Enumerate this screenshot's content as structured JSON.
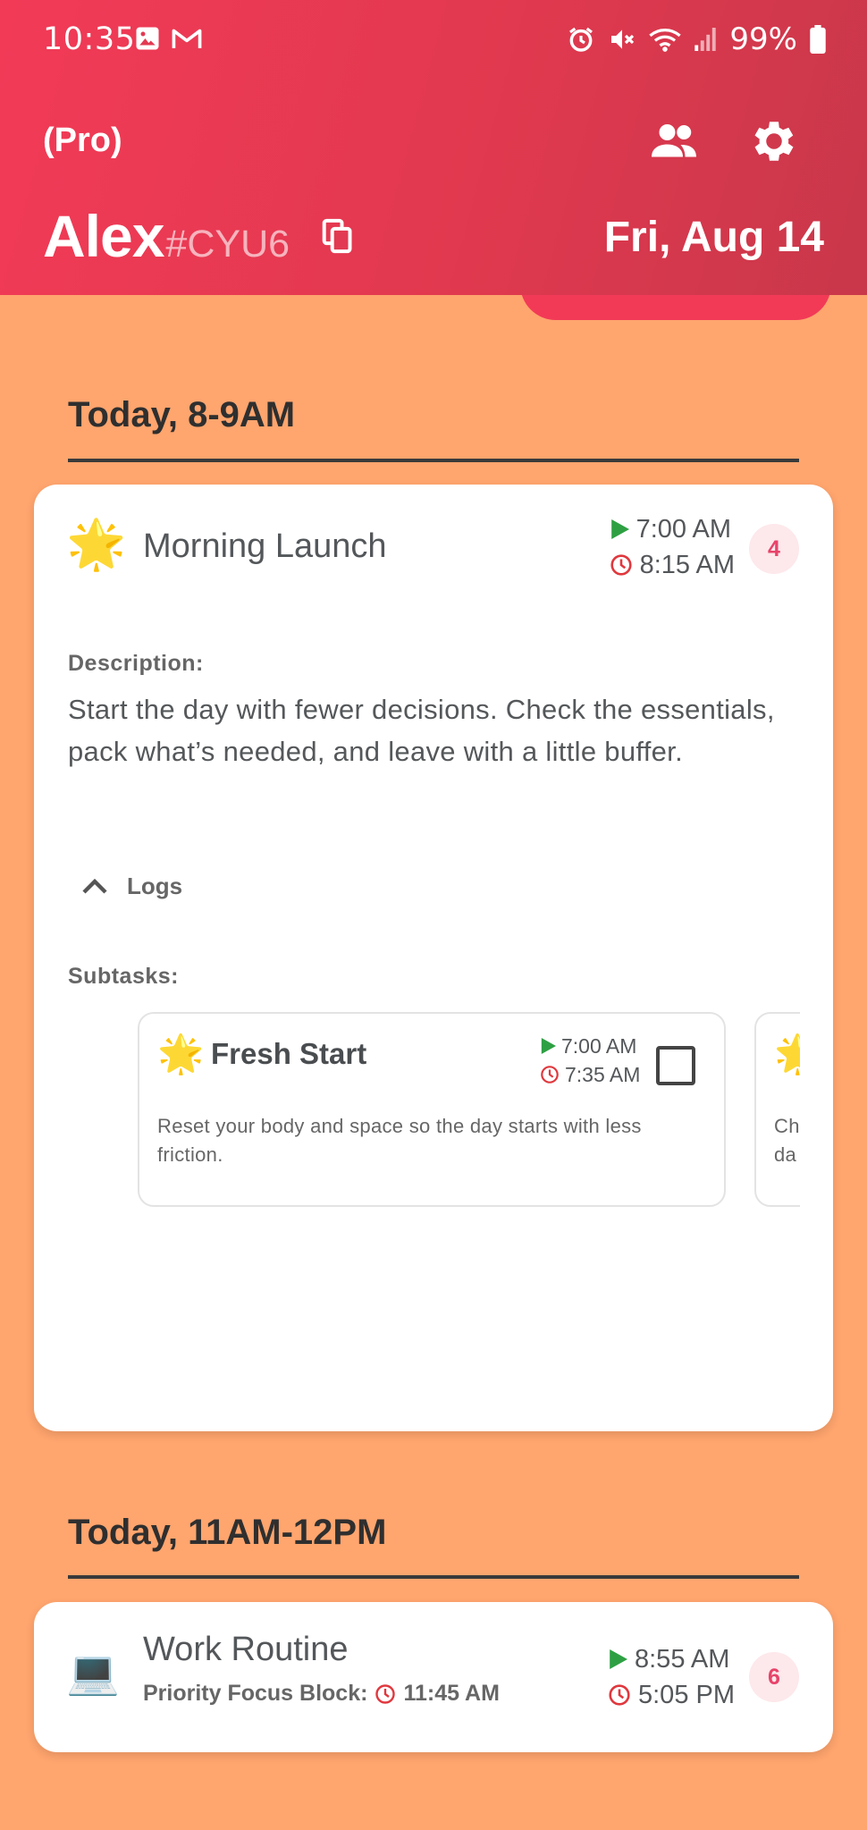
{
  "colors": {
    "header_start": "#F23A57",
    "header_end": "#C9374A",
    "background": "#FFA56E",
    "badge_text": "#E8436A",
    "play_green": "#2EA043",
    "clock_red": "#E0383E"
  },
  "status_bar": {
    "time": "10:35",
    "battery": "99%",
    "left_icons": [
      "image-icon",
      "gmail-icon"
    ],
    "right_icons": [
      "alarm-icon",
      "mute-icon",
      "wifi-icon",
      "signal-icon",
      "battery-icon"
    ]
  },
  "header": {
    "plan_label": "(Pro)",
    "user_name": "Alex",
    "user_tag": "#CYU6",
    "date": "Fri, Aug 14",
    "icons": [
      "people-icon",
      "settings-icon",
      "copy-icon"
    ]
  },
  "sections": [
    {
      "title": "Today, 8-9AM",
      "task": {
        "emoji": "🌟",
        "title": "Morning Launch",
        "start": "7:00 AM",
        "end": "8:15 AM",
        "badge": "4",
        "description_label": "Description:",
        "description": "Start the day with fewer decisions. Check the essentials, pack what’s needed, and leave with a little buffer.",
        "logs_label": "Logs",
        "subtasks_label": "Subtasks:",
        "subtasks": [
          {
            "emoji": "🌟",
            "title": "Fresh Start",
            "start": "7:00 AM",
            "end": "7:35 AM",
            "description": "Reset your body and space so the day starts with less friction.",
            "checked": false
          },
          {
            "emoji": "🌟",
            "title": "",
            "description_fragment": "Ch da"
          }
        ]
      }
    },
    {
      "title": "Today, 11AM-12PM",
      "task": {
        "emoji": "💻",
        "title": "Work Routine",
        "focus_label": "Priority Focus Block:",
        "focus_time": "11:45 AM",
        "start": "8:55 AM",
        "end": "5:05 PM",
        "badge": "6"
      }
    }
  ]
}
